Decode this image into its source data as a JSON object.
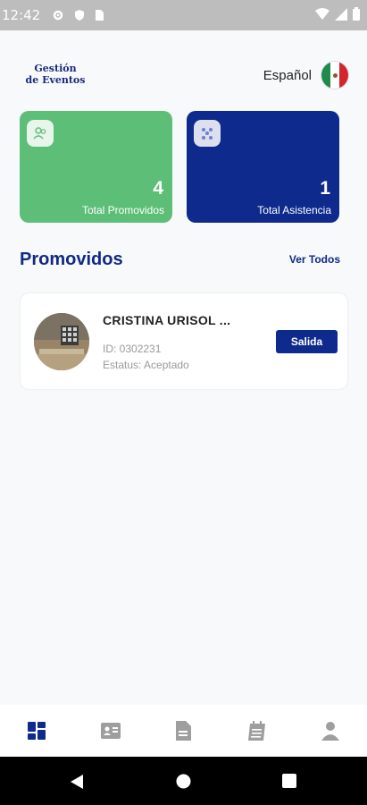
{
  "status_bar": {
    "time": "12:42"
  },
  "header": {
    "logo_line1": "Gestión",
    "logo_line2": "de Eventos",
    "language": "Español"
  },
  "stats": [
    {
      "value": "4",
      "label": "Total Promovidos",
      "color": "#5dbe78",
      "icon": "users-icon"
    },
    {
      "value": "1",
      "label": "Total Asistencia",
      "color": "#0e2a8c",
      "icon": "hierarchy-icon"
    }
  ],
  "promovidos": {
    "title": "Promovidos",
    "see_all": "Ver Todos",
    "items": [
      {
        "name": "CRISTINA URISOL ...",
        "id": "ID: 0302231",
        "status": "Estatus: Aceptado",
        "action": "Salida"
      }
    ]
  },
  "bottom_nav": [
    {
      "icon": "dashboard-icon",
      "active": true
    },
    {
      "icon": "id-card-icon",
      "active": false
    },
    {
      "icon": "document-icon",
      "active": false
    },
    {
      "icon": "calendar-icon",
      "active": false
    },
    {
      "icon": "profile-icon",
      "active": false
    }
  ],
  "colors": {
    "primary": "#0e2a8c",
    "accent_green": "#5dbe78",
    "inactive_icon": "#9e9e9e"
  }
}
